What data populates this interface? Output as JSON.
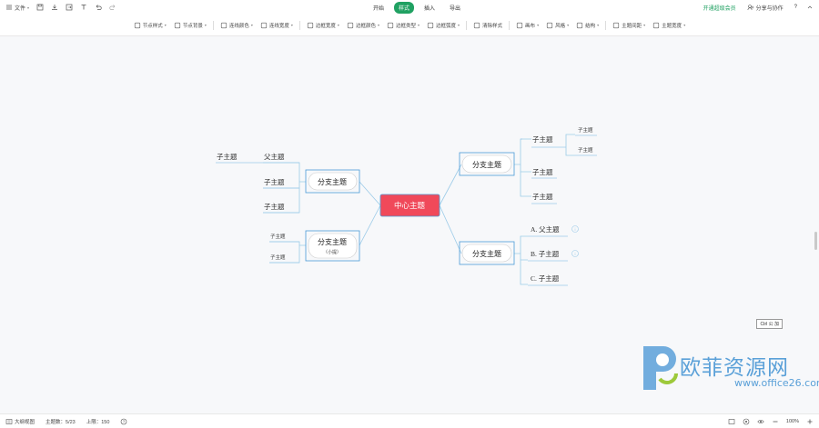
{
  "topbar": {
    "file_label": "文件",
    "tabs": [
      {
        "label": "开始",
        "active": false
      },
      {
        "label": "样式",
        "active": true
      },
      {
        "label": "插入",
        "active": false
      },
      {
        "label": "导出",
        "active": false
      }
    ],
    "vip_label": "开通超级会员",
    "share_label": "分享与协作",
    "help_label": "?"
  },
  "toolbar": {
    "items": [
      {
        "label": "节点样式",
        "icon": "node-style-icon"
      },
      {
        "label": "节点背景",
        "icon": "node-bg-icon"
      },
      {
        "label": "连线颜色",
        "icon": "line-color-icon"
      },
      {
        "label": "连线宽度",
        "icon": "line-width-icon"
      },
      {
        "label": "边框宽度",
        "icon": "border-width-icon"
      },
      {
        "label": "边框颜色",
        "icon": "border-color-icon"
      },
      {
        "label": "边框类型",
        "icon": "border-type-icon"
      },
      {
        "label": "边框弧度",
        "icon": "border-radius-icon"
      },
      {
        "label": "清除样式",
        "icon": "clear-style-icon"
      },
      {
        "label": "画布",
        "icon": "canvas-icon"
      },
      {
        "label": "风格",
        "icon": "style-icon"
      },
      {
        "label": "结构",
        "icon": "structure-icon"
      },
      {
        "label": "主题间距",
        "icon": "topic-spacing-icon"
      },
      {
        "label": "主题宽度",
        "icon": "topic-width-icon"
      }
    ]
  },
  "mindmap": {
    "center": "中心主题",
    "branch_right_top": "分支主题",
    "branch_right_bottom": "分支主题",
    "branch_left_top": "分支主题",
    "branch_left_bottom": "分支主题",
    "branch_left_bottom_sub": "（小提）",
    "rt_children": [
      "子主题",
      "子主题",
      "子主题"
    ],
    "rt_grandchildren": [
      "子主题",
      "子主题"
    ],
    "rb_children": [
      "A. 父主题",
      "B. 子主题",
      "C. 子主题"
    ],
    "lt_children": [
      "父主题",
      "子主题",
      "子主题"
    ],
    "lt_grandchild": "子主题",
    "lb_children": [
      "子主题",
      "子主题"
    ]
  },
  "statusbar": {
    "outline_label": "大纲视图",
    "topic_count": "主题数：5/23",
    "limit": "上限：150",
    "zoom": "100%"
  },
  "tooltip": "Ctrl 公 加",
  "watermark": {
    "text": "欧菲资源网",
    "url": "www.office26.com"
  },
  "colors": {
    "accent": "#20a162",
    "center_fill": "#f0495a",
    "line": "#9ccbe8",
    "branch_border": "#4a9bd6",
    "watermark": "#5aa0d8"
  }
}
